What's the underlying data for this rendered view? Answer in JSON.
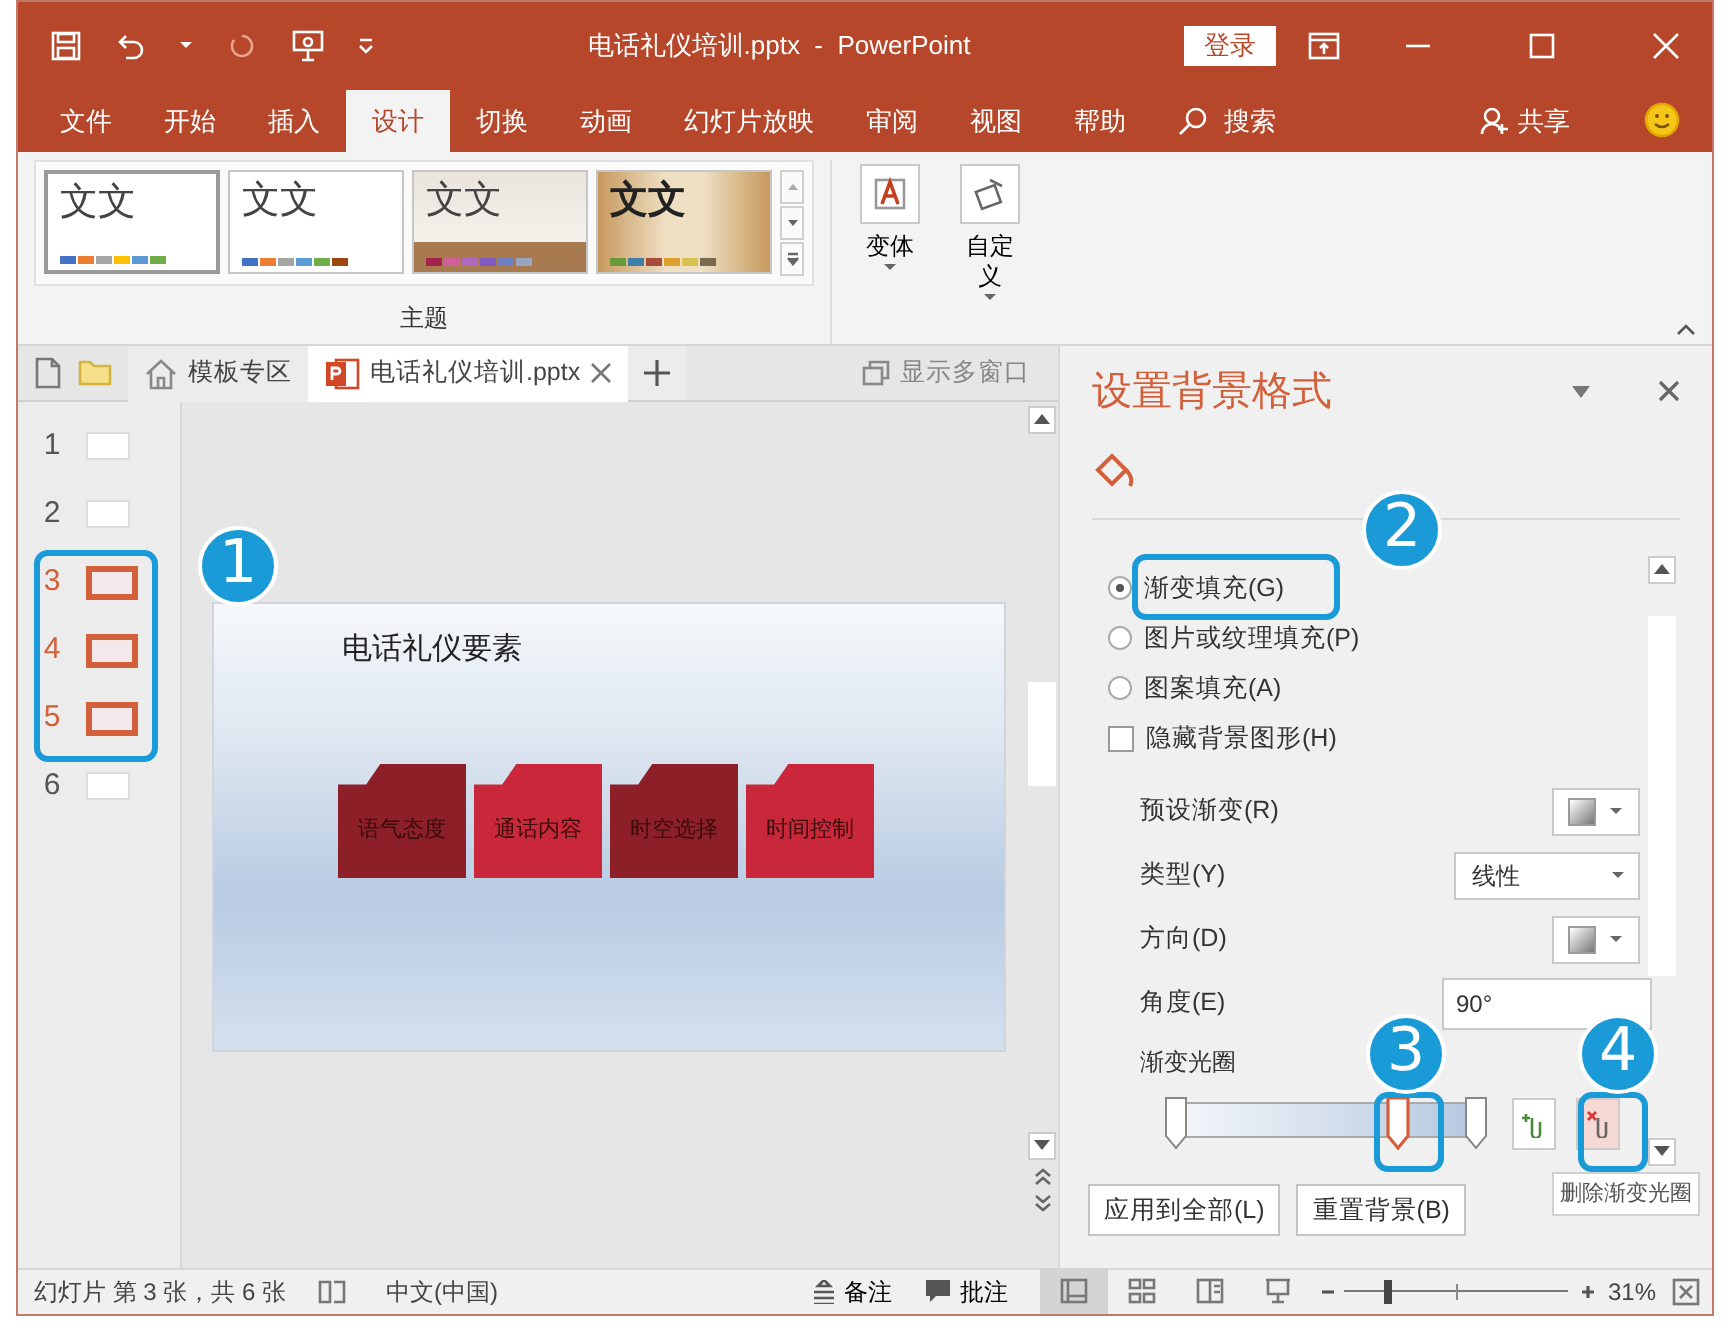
{
  "title_bar": {
    "title": "电话礼仪培训.pptx  -  PowerPoint",
    "sign_in": "登录"
  },
  "ribbon_tabs": [
    {
      "label": "文件",
      "selected": false
    },
    {
      "label": "开始",
      "selected": false
    },
    {
      "label": "插入",
      "selected": false
    },
    {
      "label": "设计",
      "selected": true
    },
    {
      "label": "切换",
      "selected": false
    },
    {
      "label": "动画",
      "selected": false
    },
    {
      "label": "幻灯片放映",
      "selected": false
    },
    {
      "label": "审阅",
      "selected": false
    },
    {
      "label": "视图",
      "selected": false
    },
    {
      "label": "帮助",
      "selected": false
    }
  ],
  "search": "搜索",
  "share": "共享",
  "themes": [
    {
      "label": "文文",
      "selected": true,
      "kind": "plain"
    },
    {
      "label": "文文",
      "selected": false,
      "kind": "plain"
    },
    {
      "label": "文文",
      "selected": false,
      "kind": "wood"
    },
    {
      "label": "文文",
      "selected": false,
      "kind": "brush"
    }
  ],
  "theme_group": "主题",
  "ribbon_buttons": [
    {
      "label": "变体",
      "kind": "variant"
    },
    {
      "label": "自定义",
      "kind": "custom"
    }
  ],
  "doc_tabs": [
    {
      "label": "模板专区",
      "kind": "home",
      "selected": false
    },
    {
      "label": "电话礼仪培训.pptx",
      "kind": "file",
      "selected": true
    }
  ],
  "multi_window": "显示多窗口",
  "slides": [
    {
      "number": "1",
      "selected": false
    },
    {
      "number": "2",
      "selected": false
    },
    {
      "number": "3",
      "selected": true
    },
    {
      "number": "4",
      "selected": true
    },
    {
      "number": "5",
      "selected": true
    },
    {
      "number": "6",
      "selected": false
    }
  ],
  "slide": {
    "title": "电话礼仪要素",
    "folders": [
      {
        "label": "语气态度",
        "color": "#8c1f28"
      },
      {
        "label": "通话内容",
        "color": "#c9283a"
      },
      {
        "label": "时空选择",
        "color": "#8c1f28"
      },
      {
        "label": "时间控制",
        "color": "#c9283a"
      }
    ]
  },
  "pane": {
    "title": "设置背景格式",
    "fill_options": [
      {
        "label": "渐变填充(G)",
        "kind": "radio",
        "checked": true
      },
      {
        "label": "图片或纹理填充(P)",
        "kind": "radio",
        "checked": false
      },
      {
        "label": "图案填充(A)",
        "kind": "radio",
        "checked": false
      },
      {
        "label": "隐藏背景图形(H)",
        "kind": "checkbox",
        "checked": false
      }
    ],
    "fields": [
      {
        "label": "预设渐变(R)",
        "kind": "swatch"
      },
      {
        "label": "类型(Y)",
        "kind": "select",
        "value": "线性"
      },
      {
        "label": "方向(D)",
        "kind": "swatch"
      },
      {
        "label": "角度(E)",
        "kind": "spin",
        "value": "90°"
      }
    ],
    "gradient_label": "渐变光圈",
    "stops": [
      {
        "level": 0,
        "selected": false
      },
      {
        "level": 0.74,
        "selected": true
      },
      {
        "level": 1,
        "selected": false
      }
    ],
    "tooltip": "删除渐变光圈",
    "buttons": [
      "应用到全部(L)",
      "重置背景(B)"
    ]
  },
  "status_bar": {
    "slide_info": "幻灯片 第 3 张，共 6 张",
    "language": "中文(中国)",
    "notes": "备注",
    "comments": "批注",
    "zoom": "31%",
    "zoom_slider": {
      "level": 0.2
    }
  },
  "callouts": [
    {
      "number": "1"
    },
    {
      "number": "2"
    },
    {
      "number": "3"
    },
    {
      "number": "4"
    }
  ]
}
